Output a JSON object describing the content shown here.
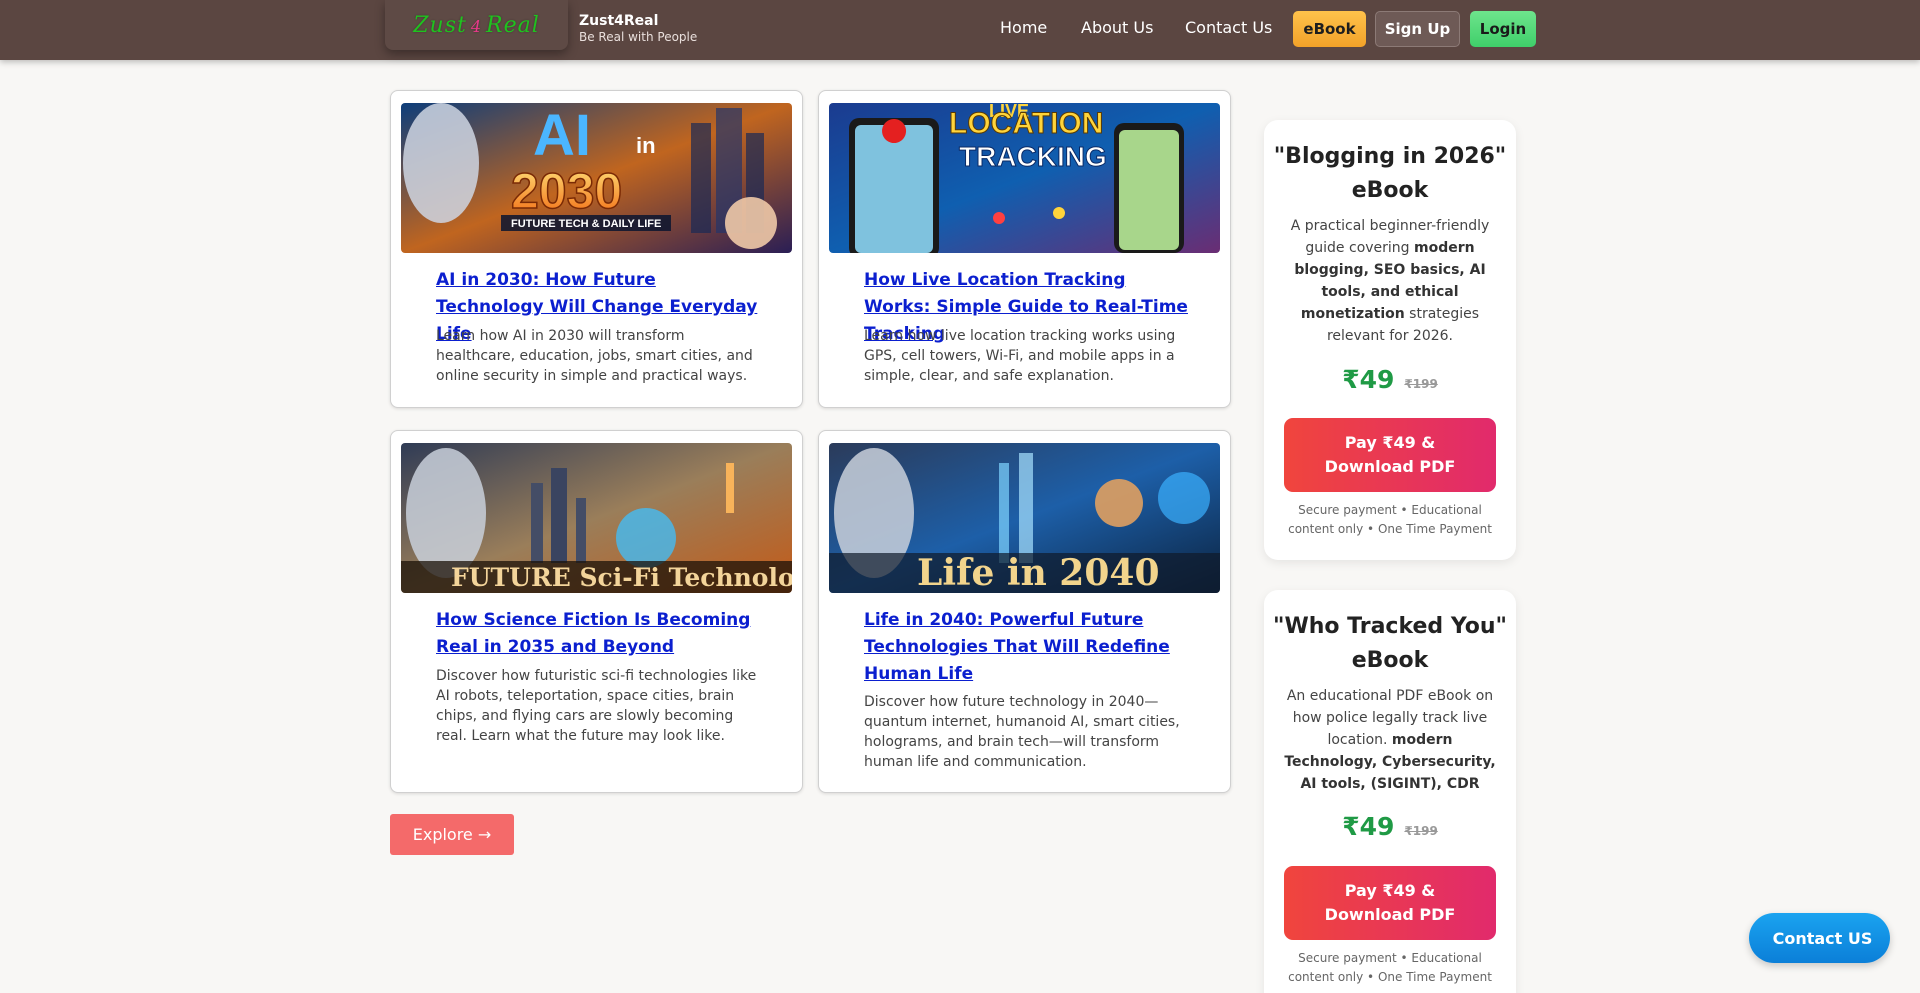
{
  "header": {
    "logo": {
      "left": "Zust",
      "amp": "4",
      "right": "Real"
    },
    "brand_name": "Zust4Real",
    "tagline": "Be Real with People",
    "nav": [
      {
        "label": "Home"
      },
      {
        "label": "About Us"
      },
      {
        "label": "Contact Us"
      }
    ],
    "ebook_label": "eBook",
    "signup_label": "Sign Up",
    "login_label": "Login"
  },
  "articles": [
    {
      "title": "AI in 2030: How Future Technology Will Change Everyday Life",
      "description": "Learn how AI in 2030 will transform healthcare, education, jobs, smart cities, and online security in simple and practical ways.",
      "image": {
        "big": "AI",
        "small": "in",
        "year": "2030",
        "caption": "FUTURE TECH & DAILY LIFE"
      }
    },
    {
      "title": "How Live Location Tracking Works: Simple Guide to Real-Time Tracking",
      "description": "Learn how live location tracking works using GPS, cell towers, Wi-Fi, and mobile apps in a simple, clear, and safe explanation.",
      "image": {
        "line1": "LIVE",
        "line2": "LOCATION",
        "line3": "TRACKING"
      }
    },
    {
      "title": "How Science Fiction Is Becoming Real in 2035 and Beyond",
      "description": "Discover how futuristic sci-fi technologies like AI robots, teleportation, space cities, brain chips, and flying cars are slowly becoming real. Learn what the future may look like.",
      "image": {
        "caption": "FUTURE Sci-Fi Technology"
      }
    },
    {
      "title": "Life in 2040: Powerful Future Technologies That Will Redefine Human Life",
      "description": "Discover how future technology in 2040—quantum internet, humanoid AI, smart cities, holograms, and brain tech—will transform human life and communication.",
      "image": {
        "caption": "Life in 2040"
      }
    }
  ],
  "explore_label": "Explore →",
  "ebooks": [
    {
      "title": "\"Blogging in 2026\" eBook",
      "desc_plain_1": "A practical beginner-friendly guide covering ",
      "desc_bold": "modern blogging, SEO basics, AI tools, and ethical monetization",
      "desc_plain_2": " strategies relevant for 2026.",
      "price_new": "₹49",
      "price_old": "₹199",
      "button": "Pay ₹49 & Download PDF",
      "secure": " Secure payment • Educational content only • One Time Payment"
    },
    {
      "title": "\"Who Tracked You\" eBook",
      "desc_plain_1": "An educational PDF eBook on how police legally track live location. ",
      "desc_bold": "modern Technology, Cybersecurity, AI tools, (SIGINT), CDR",
      "desc_plain_2": "",
      "price_new": "₹49",
      "price_old": "₹199",
      "button": "Pay ₹49 & Download PDF",
      "secure": " Secure payment • Educational content only • One Time Payment"
    }
  ],
  "contact_float_label": "Contact US",
  "colors": {
    "navbar": "#5b4641",
    "link": "#0b1fcf",
    "price": "#1f9a45",
    "explore": "#f46a6a",
    "contact": "#0b7fd8"
  }
}
